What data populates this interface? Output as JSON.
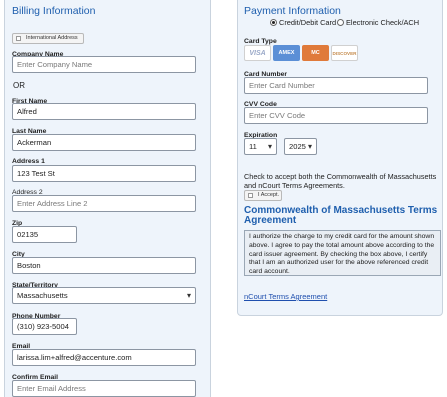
{
  "billing": {
    "title": "Billing Information",
    "international_label": "International Address",
    "company_label": "Company Name",
    "company_placeholder": "Enter Company Name",
    "or_text": "OR",
    "first_label": "First Name",
    "first_value": "Alfred",
    "last_label": "Last Name",
    "last_value": "Ackerman",
    "address1_label": "Address 1",
    "address1_value": "123 Test St",
    "address2_label": "Address 2",
    "address2_placeholder": "Enter Address Line 2",
    "zip_label": "Zip",
    "zip_value": "02135",
    "city_label": "City",
    "city_value": "Boston",
    "state_label": "State/Territory",
    "state_value": "Massachusetts",
    "phone_label": "Phone Number",
    "phone_value": "(310) 923-5004",
    "email_label": "Email",
    "email_value": "larissa.lim+alfred@accenture.com",
    "confirm_email_label": "Confirm Email",
    "confirm_email_placeholder": "Enter Email Address"
  },
  "payment": {
    "title": "Payment Information",
    "option_card": "Credit/Debit Card",
    "option_check": "Electronic Check/ACH",
    "selected_option": "card",
    "card_type_label": "Card Type",
    "cards": [
      "VISA",
      "AMEX",
      "MC",
      "DISCOVER"
    ],
    "card_colors": [
      "#ffffff",
      "#5b8fd6",
      "#e07a3a",
      "#ffffff"
    ],
    "card_number_label": "Card Number",
    "card_number_placeholder": "Enter Card Number",
    "cvv_label": "CVV Code",
    "cvv_placeholder": "Enter CVV Code",
    "expiration_label": "Expiration",
    "exp_month": "11",
    "exp_year": "2025",
    "accept_text": "Check to accept both the Commonwealth of Massachusetts and nCourt Terms Agreements.",
    "accept_button": "I Accept.",
    "terms_title": "Commonwealth of Massachusetts Terms Agreement",
    "terms_body": "I authorize the charge to my credit card for the amount shown above. I agree to pay the total amount above according to the card issuer agreement. By checking the box above, I certify that I am an authorized user for the above referenced credit card account.",
    "ncourt_link": "nCourt Terms Agreement"
  }
}
